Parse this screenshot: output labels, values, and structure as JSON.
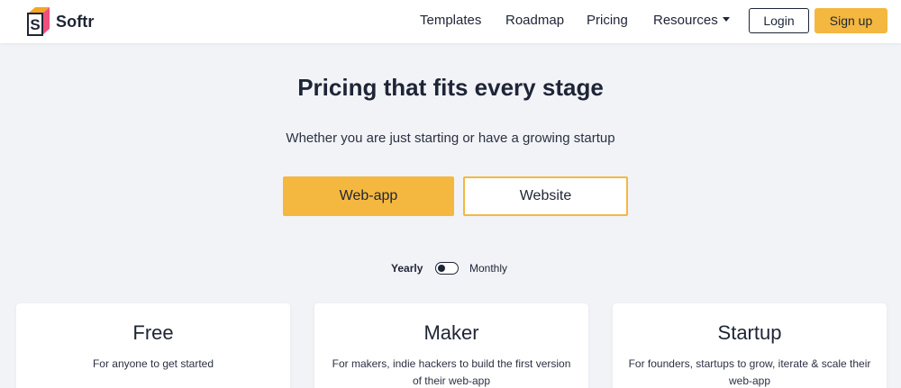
{
  "brand": {
    "name": "Softr",
    "logo_icon": "softr-cube-logo",
    "logo_letter": "S"
  },
  "nav": {
    "links": [
      "Templates",
      "Roadmap",
      "Pricing",
      "Resources"
    ],
    "login_label": "Login",
    "signup_label": "Sign up"
  },
  "hero": {
    "title": "Pricing that fits every stage",
    "subtitle": "Whether you are just starting or have a growing startup"
  },
  "product_tabs": {
    "webapp_label": "Web-app",
    "website_label": "Website",
    "selected": "Web-app"
  },
  "billing": {
    "yearly_label": "Yearly",
    "monthly_label": "Monthly",
    "selected": "Yearly"
  },
  "plans": [
    {
      "name": "Free",
      "description": "For anyone to get started"
    },
    {
      "name": "Maker",
      "description": "For makers, indie hackers to build the first version of their web-app"
    },
    {
      "name": "Startup",
      "description": "For founders, startups to grow, iterate & scale their web-app"
    }
  ],
  "colors": {
    "accent": "#f4b73f",
    "text": "#1e2536",
    "background": "#f2f3f7",
    "logo_pink": "#ef4f7d",
    "logo_orange": "#f5a623"
  }
}
